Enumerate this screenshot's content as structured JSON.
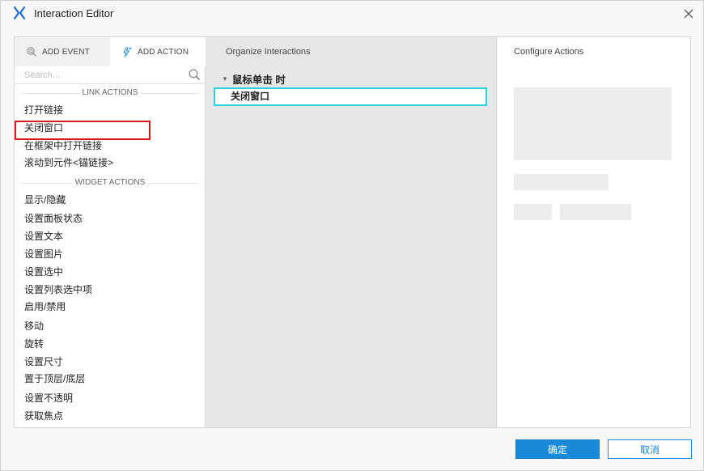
{
  "window": {
    "title": "Interaction Editor"
  },
  "left_panel": {
    "tabs": [
      {
        "label": "ADD EVENT"
      },
      {
        "label": "ADD ACTION"
      }
    ],
    "search_placeholder": "Search...",
    "sections": [
      {
        "header": "LINK ACTIONS",
        "items": [
          "打开链接",
          "关闭窗口",
          "在框架中打开链接",
          "滚动到元件<锚链接>"
        ]
      },
      {
        "header": "WIDGET ACTIONS",
        "items": [
          "显示/隐藏",
          "设置面板状态",
          "设置文本",
          "设置图片",
          "设置选中",
          "设置列表选中项",
          "启用/禁用",
          "移动",
          "旋转",
          "设置尺寸",
          "置于顶层/底层",
          "设置不透明",
          "获取焦点"
        ]
      }
    ]
  },
  "middle_panel": {
    "title": "Organize Interactions",
    "event": "鼠标单击 时",
    "action": "关闭窗口"
  },
  "right_panel": {
    "title": "Configure Actions"
  },
  "footer": {
    "ok_label": "确定",
    "cancel_label": "取消"
  },
  "colors": {
    "accent": "#1a8ad8",
    "highlight_red": "#e0141e",
    "selected_cyan": "#2fd0d8",
    "logo_blue": "#1f6fd6"
  }
}
